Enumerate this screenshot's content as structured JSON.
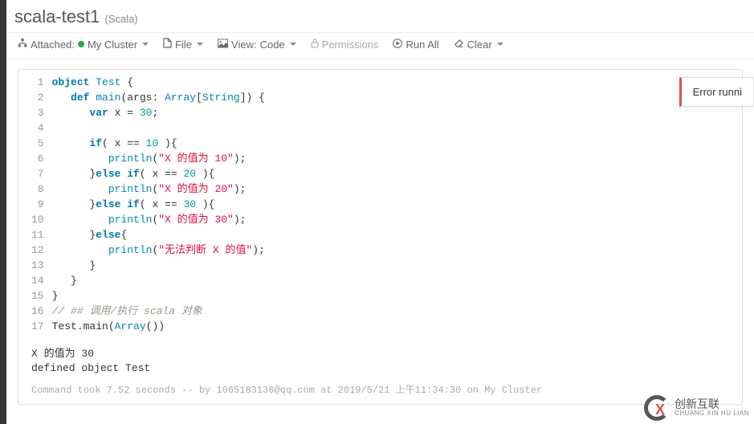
{
  "title": "scala-test1",
  "language": "Scala",
  "toolbar": {
    "attached_label": "Attached:",
    "cluster": "My Cluster",
    "file": "File",
    "view_prefix": "View:",
    "view_value": "Code",
    "permissions": "Permissions",
    "run_all": "Run All",
    "clear": "Clear"
  },
  "code": {
    "lines": [
      "1",
      "2",
      "3",
      "4",
      "5",
      "6",
      "7",
      "8",
      "9",
      "10",
      "11",
      "12",
      "13",
      "14",
      "15",
      "16",
      "17"
    ],
    "l1_object": "object",
    "l1_Test": "Test",
    "l1_brace": " {",
    "l2_def": "def",
    "l2_main": "main",
    "l2_args": "(args: ",
    "l2_Array": "Array",
    "l2_br1": "[",
    "l2_String": "String",
    "l2_br2": "]) {",
    "l3_var": "var",
    "l3_x": " x = ",
    "l3_30": "30",
    "l3_semi": ";",
    "l5_if": "if",
    "l5_cond": "( x == ",
    "l5_10": "10",
    "l5_rest": " ){",
    "l6_println": "println",
    "l6_open": "(",
    "l6_str": "\"X 的值为 10\"",
    "l6_close": ");",
    "l7_else": "else if",
    "l7_cond": "( x == ",
    "l7_20": "20",
    "l7_rest": " ){",
    "l7_cb": "}",
    "l8_println": "println",
    "l8_str": "\"X 的值为 20\"",
    "l9_else": "else if",
    "l9_cond": "( x == ",
    "l9_30": "30",
    "l9_rest": " ){",
    "l9_cb": "}",
    "l10_println": "println",
    "l10_str": "\"X 的值为 30\"",
    "l11_cb": "}",
    "l11_else": "else",
    "l11_ob": "{",
    "l12_println": "println",
    "l12_str": "\"无法判断 X 的值\"",
    "l13_cb": "}",
    "l14_cb": "}",
    "l15_cb": "}",
    "l16_cmt": "// ## 调用/执行 scala 对象",
    "l17_call": "Test.main(",
    "l17_Array": "Array",
    "l17_rest": "())"
  },
  "output": {
    "line1": "X 的值为 30",
    "line2": "defined object Test"
  },
  "cmd_info": "Command took 7.52 seconds -- by 1065183136@qq.com at 2019/5/21 上午11:34:30 on My Cluster",
  "error_toast": "Error runni",
  "watermark": {
    "text": "创新互联",
    "sub": "CHUANG XIN HU LIAN"
  }
}
